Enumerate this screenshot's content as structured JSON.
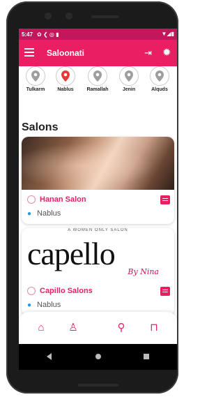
{
  "status_bar": {
    "time": "5:47",
    "icons_left": "✿ ❮ ◎ ▮",
    "icons_right": "▼◢▮"
  },
  "app_bar": {
    "title": "Saloonati"
  },
  "cities": [
    {
      "label": "Tulkarm",
      "selected": false
    },
    {
      "label": "Nablus",
      "selected": true
    },
    {
      "label": "Ramallah",
      "selected": false
    },
    {
      "label": "Jenin",
      "selected": false
    },
    {
      "label": "Alquds",
      "selected": false
    }
  ],
  "section_title": "Salons",
  "salons": [
    {
      "name": "Hanan Salon",
      "city": "Nablus"
    },
    {
      "name": "Capillo Salons",
      "city": "Nablus",
      "image_text": "capello",
      "image_subtext": "By Nina",
      "image_tagline": "A WOMEN ONLY SALON"
    }
  ],
  "colors": {
    "primary": "#e91e63",
    "status": "#c2185b",
    "location": "#2196f3"
  },
  "icons": {
    "menu": "menu-icon",
    "logout": "logout-icon",
    "theme": "sun-icon",
    "home": "home-icon",
    "profile": "person-icon",
    "search": "search-icon",
    "bag": "bag-icon",
    "chat": "chat-icon"
  }
}
